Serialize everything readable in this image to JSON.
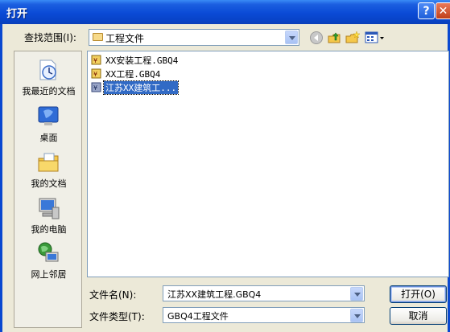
{
  "window": {
    "title": "打开",
    "help_glyph": "?",
    "close_glyph": "✕"
  },
  "toolbar": {
    "lookin_label": "查找范围(I):",
    "lookin_value": "工程文件",
    "icons": [
      "back-icon",
      "up-folder-icon",
      "new-folder-icon",
      "views-menu-icon"
    ]
  },
  "places": [
    {
      "label": "我最近的文档",
      "icon": "recent-documents-icon"
    },
    {
      "label": "桌面",
      "icon": "desktop-icon"
    },
    {
      "label": "我的文档",
      "icon": "my-documents-icon"
    },
    {
      "label": "我的电脑",
      "icon": "my-computer-icon"
    },
    {
      "label": "网上邻居",
      "icon": "network-places-icon"
    }
  ],
  "files": [
    {
      "name": "XX安装工程.GBQ4",
      "selected": false
    },
    {
      "name": "XX工程.GBQ4",
      "selected": false
    },
    {
      "name": "江苏XX建筑工...",
      "selected": true
    }
  ],
  "form": {
    "filename_label": "文件名(N):",
    "filename_value": "江苏XX建筑工程.GBQ4",
    "filetype_label": "文件类型(T):",
    "filetype_value": "GBQ4工程文件"
  },
  "buttons": {
    "open": "打开(O)",
    "cancel": "取消"
  },
  "colors": {
    "titlebar": "#0A4AD6",
    "selection": "#316AC5",
    "dialog_bg": "#ECE9D8"
  }
}
